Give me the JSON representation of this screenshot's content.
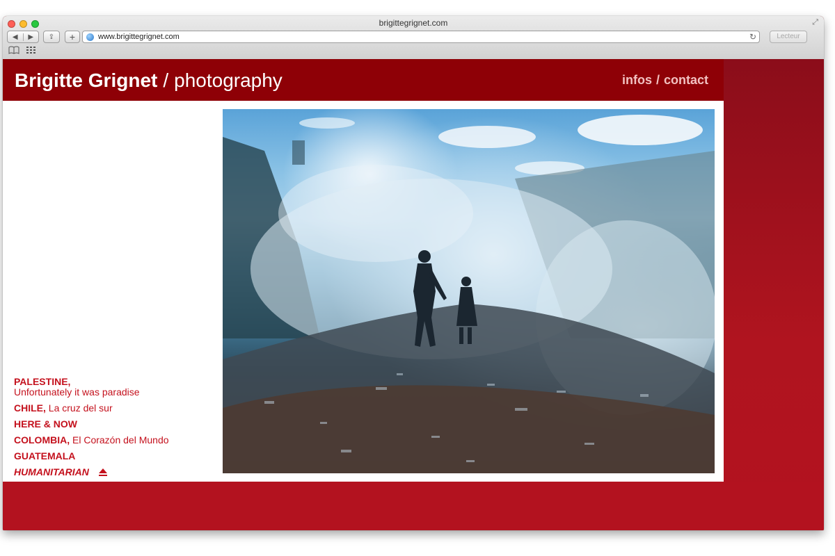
{
  "window": {
    "title": "brigittegrignet.com",
    "url": "www.brigittegrignet.com",
    "reader_label": "Lecteur",
    "colors": {
      "traffic_red": "#ff5f57",
      "traffic_yellow": "#febc2e",
      "traffic_green": "#28c840"
    },
    "icons": {
      "back": "back-arrow-icon",
      "forward": "forward-arrow-icon",
      "share": "share-icon",
      "add": "plus-icon",
      "reload": "reload-icon",
      "bookmarks": "book-icon",
      "top_sites": "grid-icon",
      "fullscreen": "fullscreen-icon"
    }
  },
  "site": {
    "brand_name": "Brigitte Grignet",
    "brand_separator": "/",
    "brand_sub": "photography",
    "nav": {
      "infos": "infos",
      "separator": "/",
      "contact": "contact"
    },
    "colors": {
      "header": "#8e0006",
      "accent": "#c4111d",
      "band": "#b3121f"
    }
  },
  "series": [
    {
      "country": "PALESTINE,",
      "subtitle": "Unfortunately it was paradise"
    },
    {
      "country": "CHILE,",
      "subtitle": "La cruz del sur"
    },
    {
      "country": "HERE & NOW",
      "subtitle": ""
    },
    {
      "country": "COLOMBIA,",
      "subtitle": "El Corazón del Mundo"
    },
    {
      "country": "GUATEMALA",
      "subtitle": ""
    },
    {
      "country": "HUMANITARIAN",
      "subtitle": "",
      "active": true
    }
  ]
}
